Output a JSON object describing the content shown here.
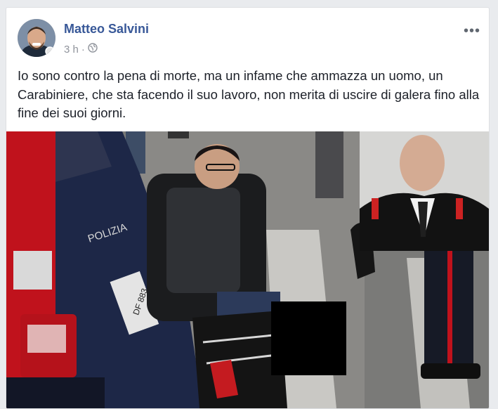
{
  "post": {
    "author": "Matteo Salvini",
    "timestamp": "3 h",
    "separator": "·",
    "privacy_icon": "globe-icon",
    "more_icon": "more-options-icon",
    "text": "Io sono contro la pena di morte, ma un infame che ammazza un uomo, un Carabiniere, che sta facendo il suo lavoro, non merita di uscire di galera fino alla fine dei suoi giorni."
  },
  "photo": {
    "car_label": "POLIZIA",
    "plate": "DF 883"
  }
}
